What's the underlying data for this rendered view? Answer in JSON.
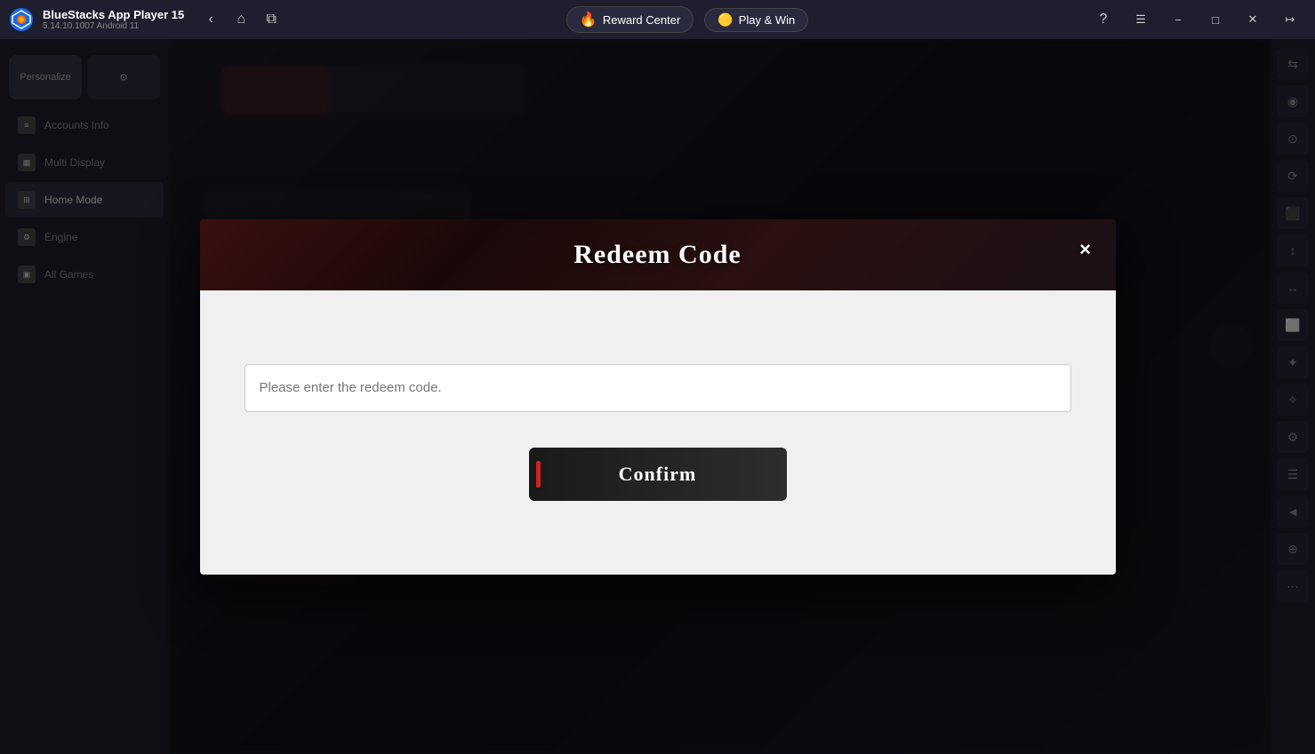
{
  "titleBar": {
    "appName": "BlueStacks App Player 15",
    "version": "5.14.10.1007  Android 11",
    "rewardCenter": "Reward Center",
    "playAndWin": "Play & Win"
  },
  "sidebar": {
    "topBtn1": "Personalize",
    "topBtn2": "⚙",
    "items": [
      {
        "label": "Accounts Info",
        "active": false
      },
      {
        "label": "Multi Display",
        "active": false
      },
      {
        "label": "Home Mode",
        "active": true
      },
      {
        "label": "Engine",
        "active": false
      },
      {
        "label": "All Games",
        "active": false
      }
    ]
  },
  "modal": {
    "title": "Redeem Code",
    "closeLabel": "×",
    "inputPlaceholder": "Please enter the redeem code.",
    "confirmLabel": "Confirm"
  },
  "rightSidebar": {
    "icons": [
      "◉",
      "☰",
      "◎",
      "⟳",
      "⬛",
      "↕",
      "↔",
      "⬜",
      "✦",
      "☆",
      "⚙",
      "☰",
      "◄",
      "⊙",
      "⋯"
    ]
  }
}
